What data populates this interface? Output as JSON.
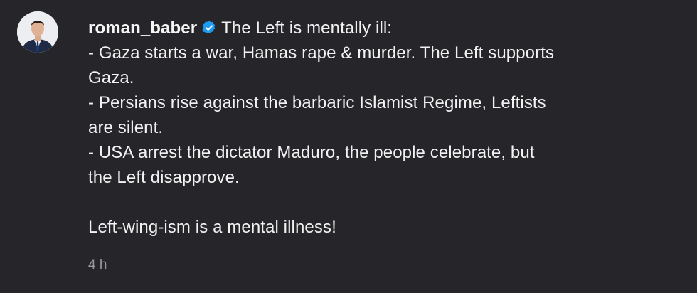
{
  "comment": {
    "author": "roman_baber",
    "verified_icon": "verified-badge-icon",
    "accent_color": "#1d9bf0",
    "first_line": "The Left is mentally ill:",
    "lines": [
      "- Gaza starts a war, Hamas rape & murder. The Left supports",
      "Gaza.",
      "- Persians rise against the barbaric Islamist Regime, Leftists",
      "are silent.",
      "- USA arrest the dictator Maduro, the people celebrate, but",
      "the Left disapprove."
    ],
    "closing": "Left-wing-ism is a mental illness!",
    "timestamp": "4 h"
  }
}
